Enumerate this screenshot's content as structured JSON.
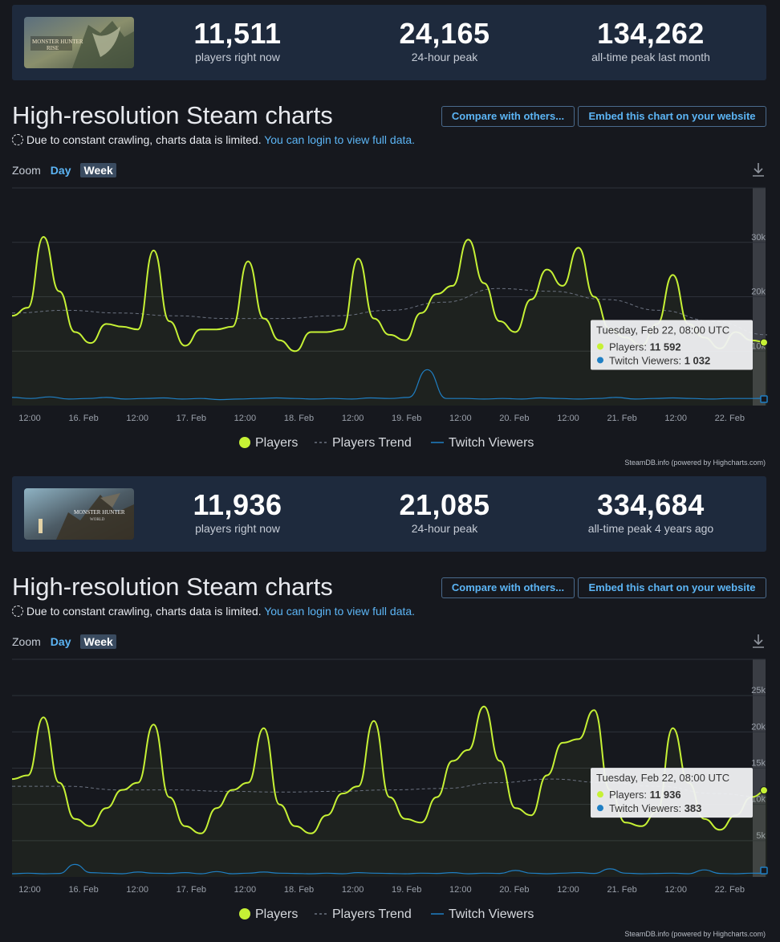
{
  "sections": [
    {
      "game_image": "Monster Hunter Rise",
      "stats": [
        {
          "value": "11,511",
          "label": "players right now"
        },
        {
          "value": "24,165",
          "label": "24-hour peak"
        },
        {
          "value": "134,262",
          "label": "all-time peak last month"
        }
      ],
      "heading": "High-resolution Steam charts",
      "buttons": {
        "compare": "Compare with others...",
        "embed": "Embed this chart on your website"
      },
      "notice": {
        "text": "Due to constant crawling, charts data is limited.",
        "link": "You can login to view full data."
      },
      "zoom": {
        "label": "Zoom",
        "day": "Day",
        "week": "Week"
      },
      "credits": "SteamDB.info (powered by Highcharts.com)"
    },
    {
      "game_image": "Monster Hunter World",
      "stats": [
        {
          "value": "11,936",
          "label": "players right now"
        },
        {
          "value": "21,085",
          "label": "24-hour peak"
        },
        {
          "value": "334,684",
          "label": "all-time peak 4 years ago"
        }
      ],
      "heading": "High-resolution Steam charts",
      "buttons": {
        "compare": "Compare with others...",
        "embed": "Embed this chart on your website"
      },
      "notice": {
        "text": "Due to constant crawling, charts data is limited.",
        "link": "You can login to view full data."
      },
      "zoom": {
        "label": "Zoom",
        "day": "Day",
        "week": "Week"
      },
      "credits": "SteamDB.info (powered by Highcharts.com)"
    }
  ],
  "colors": {
    "players": "#c6f135",
    "trend": "#6b7280",
    "twitch": "#1f7fc4",
    "background": "#16181e",
    "panel": "#1e2a3d",
    "link": "#5cb5f5"
  },
  "chart_data": [
    {
      "type": "line",
      "x_tick_labels": [
        "12:00",
        "16. Feb",
        "12:00",
        "17. Feb",
        "12:00",
        "18. Feb",
        "12:00",
        "19. Feb",
        "12:00",
        "20. Feb",
        "12:00",
        "21. Feb",
        "12:00",
        "22. Feb"
      ],
      "y_tick_labels": [
        "10k",
        "20k",
        "30k"
      ],
      "ylim": [
        0,
        40000
      ],
      "legend": [
        "Players",
        "Players Trend",
        "Twitch Viewers"
      ],
      "legend_position": "bottom-center",
      "tooltip": {
        "title": "Tuesday, Feb 22, 08:00 UTC",
        "players_label": "Players:",
        "players_value": "11 592",
        "twitch_label": "Twitch Viewers:",
        "twitch_value": "1 032"
      },
      "series": [
        {
          "name": "Players",
          "x_hours": [
            0,
            3,
            6,
            9,
            12,
            15,
            18,
            21,
            24,
            27,
            30,
            33,
            36,
            39,
            42,
            45,
            48,
            51,
            54,
            57,
            60,
            63,
            66,
            69,
            72,
            75,
            78,
            81,
            84,
            87,
            90,
            93,
            96,
            99,
            102,
            105,
            108,
            111,
            114,
            117,
            120,
            123,
            126,
            129,
            132,
            135,
            138,
            141,
            144,
            147,
            150,
            153,
            156,
            159,
            162,
            165,
            168,
            171,
            174,
            177,
            180,
            183,
            186
          ],
          "values": [
            16500,
            18000,
            31000,
            21000,
            13500,
            11500,
            15000,
            14500,
            14000,
            28500,
            15500,
            11000,
            14000,
            14000,
            14500,
            26500,
            16000,
            12000,
            10000,
            13500,
            13500,
            14000,
            27000,
            16000,
            13000,
            12000,
            17000,
            20500,
            22000,
            30500,
            22500,
            15500,
            13500,
            19500,
            25000,
            22000,
            29000,
            20000,
            14000,
            12500,
            11000,
            15000,
            24000,
            15000,
            12500,
            10500,
            13500,
            12000,
            11592
          ],
          "x_hours_explicit": true
        },
        {
          "name": "Players Trend",
          "values": [
            17000,
            17500,
            17000,
            16500,
            16000,
            16000,
            16500,
            17500,
            19000,
            21500,
            21000,
            19500,
            17500,
            15500,
            13000
          ]
        },
        {
          "name": "Twitch Viewers",
          "values": [
            1200,
            1000,
            1300,
            900,
            1000,
            1200,
            900,
            1000,
            1100,
            900,
            1000,
            800,
            900,
            1000,
            1100,
            1000,
            900,
            1000,
            900,
            1100,
            1000,
            1200,
            6300,
            1000,
            1000,
            900,
            1000,
            900,
            1100,
            1000,
            900,
            1000,
            1200,
            900,
            1000,
            1100,
            1000,
            900,
            1000,
            1000,
            1032
          ]
        }
      ]
    },
    {
      "type": "line",
      "x_tick_labels": [
        "12:00",
        "16. Feb",
        "12:00",
        "17. Feb",
        "12:00",
        "18. Feb",
        "12:00",
        "19. Feb",
        "12:00",
        "20. Feb",
        "12:00",
        "21. Feb",
        "12:00",
        "22. Feb"
      ],
      "y_tick_labels": [
        "5k",
        "10k",
        "15k",
        "20k",
        "25k"
      ],
      "ylim": [
        0,
        30000
      ],
      "legend": [
        "Players",
        "Players Trend",
        "Twitch Viewers"
      ],
      "legend_position": "bottom-center",
      "tooltip": {
        "title": "Tuesday, Feb 22, 08:00 UTC",
        "players_label": "Players:",
        "players_value": "11 936",
        "twitch_label": "Twitch Viewers:",
        "twitch_value": "383"
      },
      "series": [
        {
          "name": "Players",
          "values": [
            13500,
            14000,
            22000,
            13000,
            8000,
            7000,
            9500,
            12000,
            13000,
            21000,
            11000,
            7000,
            6000,
            9500,
            12000,
            13000,
            20500,
            10000,
            7000,
            6000,
            8500,
            11500,
            12500,
            21500,
            11000,
            8000,
            7500,
            11000,
            16000,
            17500,
            23500,
            16000,
            9500,
            8500,
            14000,
            18500,
            19000,
            23000,
            12000,
            7500,
            7000,
            9000,
            20500,
            13000,
            8000,
            6500,
            8500,
            11000,
            11936
          ]
        },
        {
          "name": "Players Trend",
          "values": [
            12500,
            12500,
            12000,
            12000,
            11800,
            11700,
            11800,
            12000,
            12200,
            13000,
            13500,
            13000,
            12500,
            11500,
            11000
          ]
        },
        {
          "name": "Twitch Viewers",
          "values": [
            300,
            400,
            300,
            350,
            2000,
            500,
            400,
            300,
            600,
            400,
            350,
            500,
            300,
            700,
            300,
            400,
            600,
            400,
            350,
            300,
            400,
            300,
            500,
            400,
            350,
            300,
            400,
            350,
            500,
            300,
            400,
            350,
            900,
            400,
            300,
            400,
            500,
            350,
            1200,
            400,
            300,
            350,
            400,
            300,
            1000,
            350,
            300,
            400,
            383
          ]
        }
      ]
    }
  ]
}
